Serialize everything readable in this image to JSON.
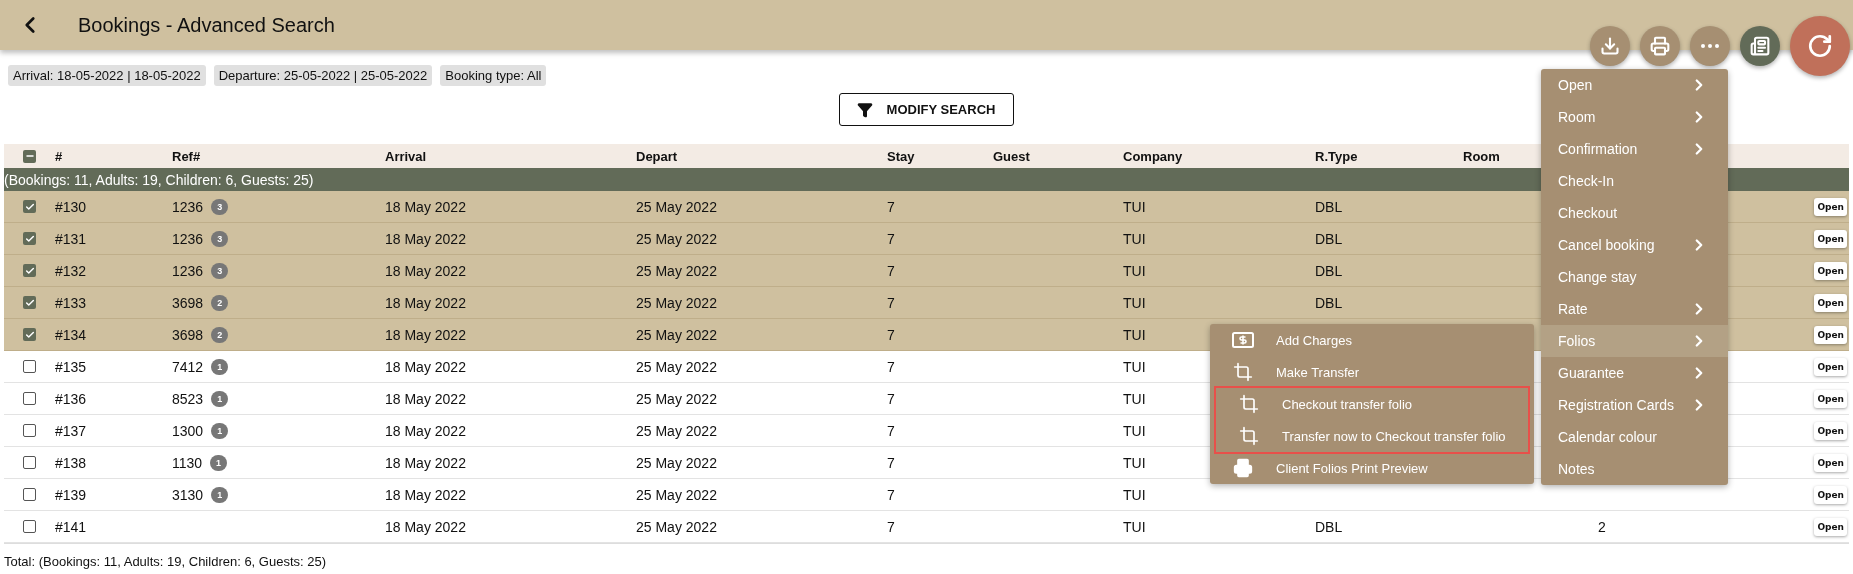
{
  "header": {
    "title": "Bookings - Advanced Search"
  },
  "filters": [
    "Arrival: 18-05-2022 | 18-05-2022",
    "Departure: 25-05-2022 | 25-05-2022",
    "Booking type: All"
  ],
  "modify_button": "MODIFY SEARCH",
  "actions": [
    {
      "kind": "download"
    },
    {
      "kind": "print"
    },
    {
      "kind": "more"
    },
    {
      "kind": "notes"
    },
    {
      "kind": "refresh"
    }
  ],
  "table": {
    "select_all_indeterminate": true,
    "columns": [
      "#",
      "Ref#",
      "Arrival",
      "Depart",
      "Stay",
      "Guest",
      "Company",
      "R.Type",
      "Room"
    ],
    "group_summary": "(Bookings: 11, Adults: 19, Children: 6, Guests: 25)",
    "rows": [
      {
        "selected": true,
        "number": "#130",
        "ref": "1236",
        "ref_count": "3",
        "arrival": "18 May 2022",
        "depart": "25 May 2022",
        "stay": "7",
        "company": "TUI",
        "r_type": "DBL",
        "open": "Open"
      },
      {
        "selected": true,
        "number": "#131",
        "ref": "1236",
        "ref_count": "3",
        "arrival": "18 May 2022",
        "depart": "25 May 2022",
        "stay": "7",
        "company": "TUI",
        "r_type": "DBL",
        "open": "Open"
      },
      {
        "selected": true,
        "number": "#132",
        "ref": "1236",
        "ref_count": "3",
        "arrival": "18 May 2022",
        "depart": "25 May 2022",
        "stay": "7",
        "company": "TUI",
        "r_type": "DBL",
        "open": "Open"
      },
      {
        "selected": true,
        "number": "#133",
        "ref": "3698",
        "ref_count": "2",
        "arrival": "18 May 2022",
        "depart": "25 May 2022",
        "stay": "7",
        "company": "TUI",
        "r_type": "DBL",
        "open": "Open"
      },
      {
        "selected": true,
        "number": "#134",
        "ref": "3698",
        "ref_count": "2",
        "arrival": "18 May 2022",
        "depart": "25 May 2022",
        "stay": "7",
        "company": "TUI",
        "open": "Open"
      },
      {
        "selected": false,
        "number": "#135",
        "ref": "7412",
        "ref_count": "1",
        "arrival": "18 May 2022",
        "depart": "25 May 2022",
        "stay": "7",
        "company": "TUI",
        "open": "Open"
      },
      {
        "selected": false,
        "number": "#136",
        "ref": "8523",
        "ref_count": "1",
        "arrival": "18 May 2022",
        "depart": "25 May 2022",
        "stay": "7",
        "company": "TUI",
        "open": "Open"
      },
      {
        "selected": false,
        "number": "#137",
        "ref": "1300",
        "ref_count": "1",
        "arrival": "18 May 2022",
        "depart": "25 May 2022",
        "stay": "7",
        "company": "TUI",
        "open": "Open"
      },
      {
        "selected": false,
        "number": "#138",
        "ref": "1130",
        "ref_count": "1",
        "arrival": "18 May 2022",
        "depart": "25 May 2022",
        "stay": "7",
        "company": "TUI",
        "open": "Open"
      },
      {
        "selected": false,
        "number": "#139",
        "ref": "3130",
        "ref_count": "1",
        "arrival": "18 May 2022",
        "depart": "25 May 2022",
        "stay": "7",
        "company": "TUI",
        "open": "Open"
      },
      {
        "selected": false,
        "number": "#141",
        "arrival": "18 May 2022",
        "depart": "25 May 2022",
        "stay": "7",
        "company": "TUI",
        "r_type": "DBL",
        "column_10": "2",
        "open": "Open"
      }
    ]
  },
  "total": "Total: (Bookings: 11, Adults: 19, Children: 6, Guests: 25)",
  "context_menu": {
    "items": [
      {
        "label": "Open",
        "submenu": true,
        "selected": false
      },
      {
        "label": "Room",
        "submenu": true,
        "selected": false
      },
      {
        "label": "Confirmation",
        "submenu": true,
        "selected": false
      },
      {
        "label": "Check-In",
        "submenu": false,
        "selected": false
      },
      {
        "label": "Checkout",
        "submenu": false,
        "selected": false
      },
      {
        "label": "Cancel booking",
        "submenu": true,
        "selected": false
      },
      {
        "label": "Change stay",
        "submenu": false,
        "selected": false
      },
      {
        "label": "Rate",
        "submenu": true,
        "selected": false
      },
      {
        "label": "Folios",
        "submenu": true,
        "selected": true
      },
      {
        "label": "Guarantee",
        "submenu": true,
        "selected": false
      },
      {
        "label": "Registration Cards",
        "submenu": true,
        "selected": false
      },
      {
        "label": "Calendar colour",
        "submenu": false,
        "selected": false
      },
      {
        "label": "Notes",
        "submenu": false,
        "selected": false
      }
    ]
  },
  "submenu": {
    "items": [
      {
        "kind": "money",
        "label": "Add Charges",
        "highlighted": false
      },
      {
        "kind": "crop",
        "label": "Make Transfer",
        "highlighted": false
      },
      {
        "kind": "crop",
        "label": "Checkout transfer folio",
        "highlighted": true
      },
      {
        "kind": "crop",
        "label": "Transfer now to Checkout transfer folio",
        "highlighted": true
      },
      {
        "kind": "print",
        "label": "Client Folios Print Preview",
        "highlighted": false
      }
    ]
  }
}
